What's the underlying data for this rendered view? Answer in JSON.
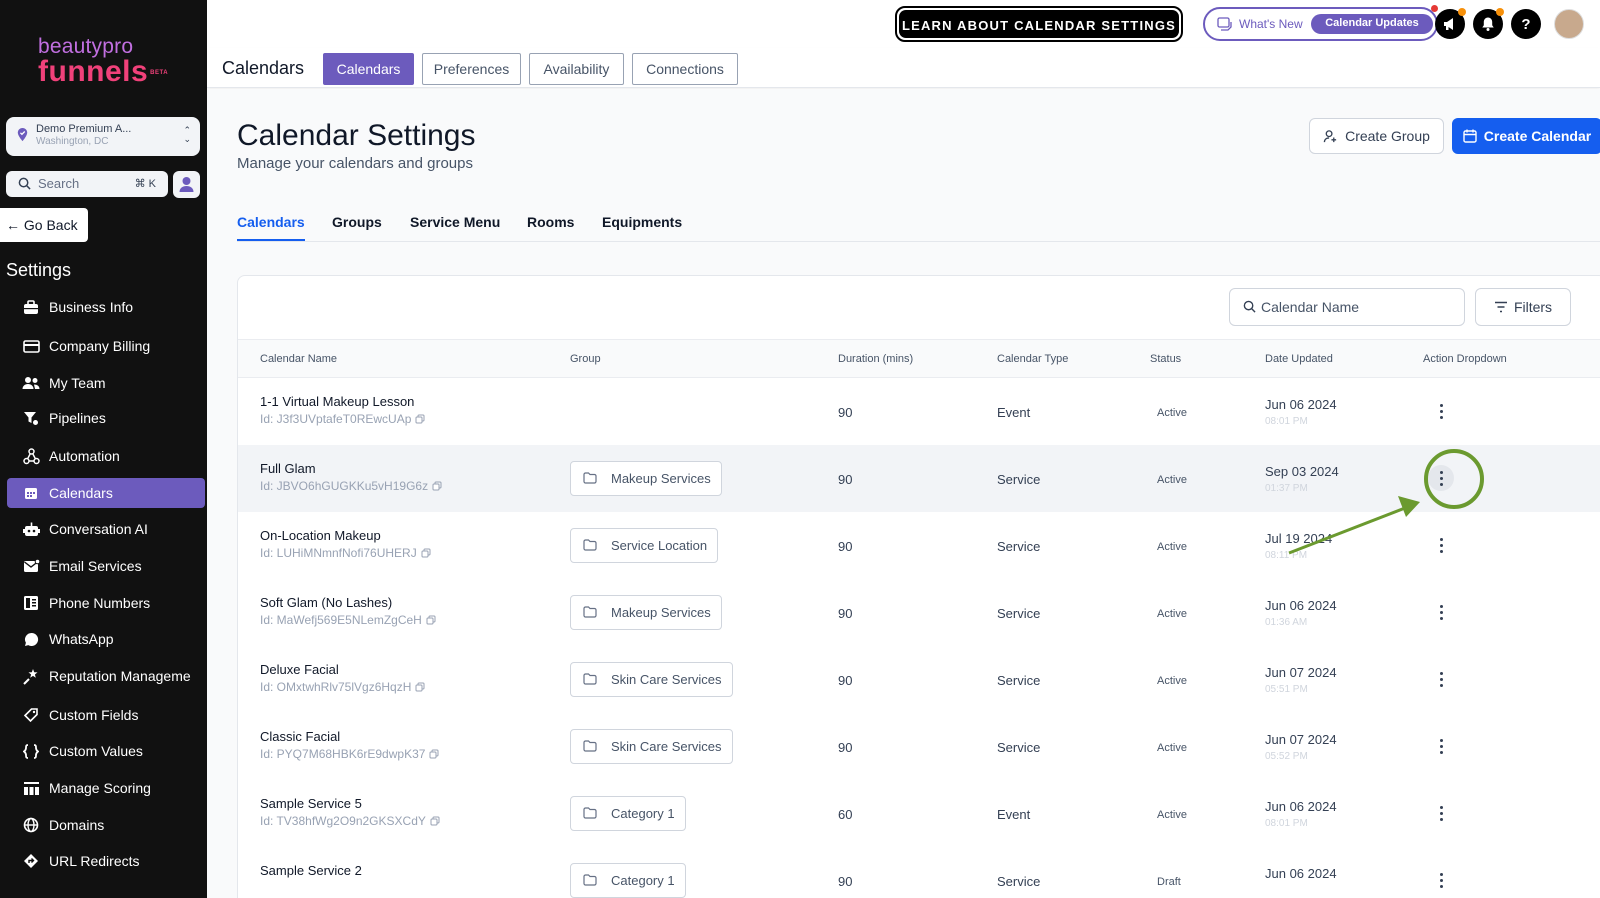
{
  "brand": {
    "line1": "beautypro",
    "line2": "funnels",
    "beta": "BETA"
  },
  "location": {
    "name": "Demo Premium A...",
    "city": "Washington, DC"
  },
  "sidebar_search": {
    "label": "Search",
    "shortcut": "⌘ K"
  },
  "go_back": "Go Back",
  "settings_title": "Settings",
  "nav_items": [
    {
      "label": "Business Info",
      "icon": "briefcase-icon"
    },
    {
      "label": "Company Billing",
      "icon": "billing-icon"
    },
    {
      "label": "My Team",
      "icon": "team-icon"
    },
    {
      "label": "Pipelines",
      "icon": "filter-icon"
    },
    {
      "label": "Automation",
      "icon": "automation-icon"
    },
    {
      "label": "Calendars",
      "icon": "calendar-icon",
      "active": true
    },
    {
      "label": "Conversation AI",
      "icon": "robot-icon"
    },
    {
      "label": "Email Services",
      "icon": "email-icon"
    },
    {
      "label": "Phone Numbers",
      "icon": "phone-icon"
    },
    {
      "label": "WhatsApp",
      "icon": "whatsapp-icon"
    },
    {
      "label": "Reputation Manageme",
      "icon": "star-icon"
    },
    {
      "label": "Custom Fields",
      "icon": "tag-icon"
    },
    {
      "label": "Custom Values",
      "icon": "braces-icon"
    },
    {
      "label": "Manage Scoring",
      "icon": "scoring-icon"
    },
    {
      "label": "Domains",
      "icon": "globe-icon"
    },
    {
      "label": "URL Redirects",
      "icon": "redirect-icon"
    }
  ],
  "topbar": {
    "learn": "LEARN ABOUT CALENDAR SETTINGS",
    "whats_new": "What's New",
    "calendar_updates": "Calendar Updates"
  },
  "subheader": {
    "title": "Calendars",
    "tabs": [
      "Calendars",
      "Preferences",
      "Availability",
      "Connections"
    ]
  },
  "page": {
    "title": "Calendar Settings",
    "subtitle": "Manage your calendars and groups",
    "create_group": "Create Group",
    "create_calendar": "Create Calendar"
  },
  "subtabs": [
    "Calendars",
    "Groups",
    "Service Menu",
    "Rooms",
    "Equipments"
  ],
  "table": {
    "search_placeholder": "Calendar Name",
    "filters": "Filters",
    "headers": [
      "Calendar Name",
      "Group",
      "Duration (mins)",
      "Calendar Type",
      "Status",
      "Date Updated",
      "Action Dropdown"
    ],
    "rows": [
      {
        "name": "1-1 Virtual Makeup Lesson",
        "id": "Id: J3f3UVptafeT0REwcUAp",
        "group": "",
        "duration": "90",
        "type": "Event",
        "status": "Active",
        "date": "Jun 06 2024",
        "time": "08:01 PM"
      },
      {
        "name": "Full Glam",
        "id": "Id: JBVO6hGUGKKu5vH19G6z",
        "group": "Makeup Services",
        "duration": "90",
        "type": "Service",
        "status": "Active",
        "date": "Sep 03 2024",
        "time": "01:37 PM"
      },
      {
        "name": "On-Location Makeup",
        "id": "Id: LUHiMNmnfNofi76UHERJ",
        "group": "Service Location",
        "duration": "90",
        "type": "Service",
        "status": "Active",
        "date": "Jul 19 2024",
        "time": "08:11 PM"
      },
      {
        "name": "Soft Glam (No Lashes)",
        "id": "Id: MaWefj569E5NLemZgCeH",
        "group": "Makeup Services",
        "duration": "90",
        "type": "Service",
        "status": "Active",
        "date": "Jun 06 2024",
        "time": "01:36 AM"
      },
      {
        "name": "Deluxe Facial",
        "id": "Id: OMxtwhRlv75lVgz6HqzH",
        "group": "Skin Care Services",
        "duration": "90",
        "type": "Service",
        "status": "Active",
        "date": "Jun 07 2024",
        "time": "05:51 PM"
      },
      {
        "name": "Classic Facial",
        "id": "Id: PYQ7M68HBK6rE9dwpK37",
        "group": "Skin Care Services",
        "duration": "90",
        "type": "Service",
        "status": "Active",
        "date": "Jun 07 2024",
        "time": "05:52 PM"
      },
      {
        "name": "Sample Service 5",
        "id": "Id: TV38hfWg2O9n2GKSXCdY",
        "group": "Category 1",
        "duration": "60",
        "type": "Event",
        "status": "Active",
        "date": "Jun 06 2024",
        "time": "08:01 PM"
      },
      {
        "name": "Sample Service 2",
        "id": "",
        "group": "Category 1",
        "duration": "90",
        "type": "Service",
        "status": "Draft",
        "date": "Jun 06 2024",
        "time": ""
      }
    ]
  },
  "colors": {
    "accent": "#6c5bbd",
    "primary": "#155eef",
    "annotation": "#6b9a2f",
    "sidebar": "#111111"
  }
}
